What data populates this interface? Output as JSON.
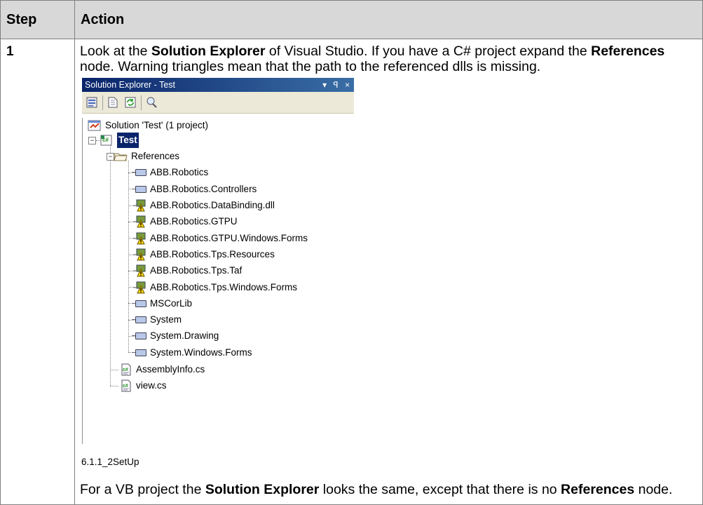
{
  "table": {
    "header": {
      "step": "Step",
      "action": "Action"
    },
    "row": {
      "step": "1",
      "p1": {
        "a": "Look at the ",
        "b": "Solution Explorer",
        "c": " of Visual Studio. If you have a C# project expand the ",
        "d": "References",
        "e": " node. Warning triangles mean that the path to the referenced dlls is missing."
      },
      "caption": "6.1.1_2SetUp",
      "p2": {
        "a": "For a VB project the ",
        "b": "Solution Explorer",
        "c": " looks the same, except that there is no ",
        "d": "References",
        "e": " node."
      }
    }
  },
  "solution_explorer": {
    "title": "Solution Explorer - Test",
    "title_controls": "▾ ꟼ ×",
    "toolbar": [
      "properties-icon",
      "show-all-files-icon",
      "refresh-icon",
      "view-class-diagram-icon"
    ],
    "solution": "Solution 'Test' (1 project)",
    "project": "Test",
    "references_folder": "References",
    "references": [
      {
        "name": "ABB.Robotics",
        "warning": false
      },
      {
        "name": "ABB.Robotics.Controllers",
        "warning": false
      },
      {
        "name": "ABB.Robotics.DataBinding.dll",
        "warning": true
      },
      {
        "name": "ABB.Robotics.GTPU",
        "warning": true
      },
      {
        "name": "ABB.Robotics.GTPU.Windows.Forms",
        "warning": true
      },
      {
        "name": "ABB.Robotics.Tps.Resources",
        "warning": true
      },
      {
        "name": "ABB.Robotics.Tps.Taf",
        "warning": true
      },
      {
        "name": "ABB.Robotics.Tps.Windows.Forms",
        "warning": true
      },
      {
        "name": "MSCorLib",
        "warning": false
      },
      {
        "name": "System",
        "warning": false
      },
      {
        "name": "System.Drawing",
        "warning": false
      },
      {
        "name": "System.Windows.Forms",
        "warning": false
      }
    ],
    "files": [
      "AssemblyInfo.cs",
      "view.cs"
    ]
  }
}
